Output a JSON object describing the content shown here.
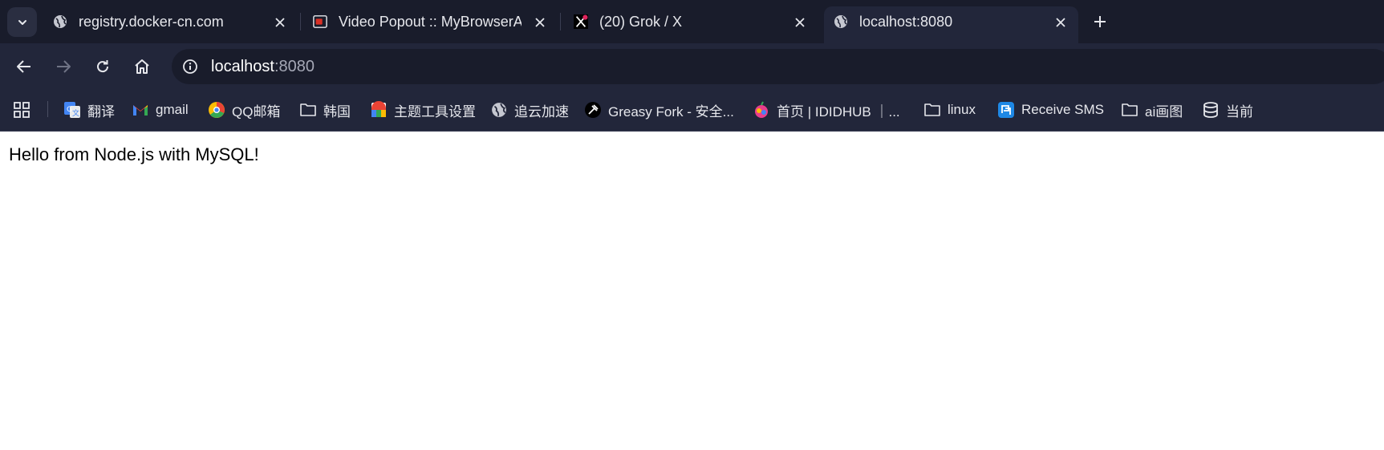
{
  "tabs": [
    {
      "title": "registry.docker-cn.com",
      "favicon": "globe-icon",
      "active": false
    },
    {
      "title": "Video Popout :: MyBrowserAd",
      "favicon": "video-popout-icon",
      "active": false
    },
    {
      "title": "(20) Grok / X",
      "favicon": "x-logo-icon",
      "active": false
    },
    {
      "title": "localhost:8080",
      "favicon": "globe-icon",
      "active": true
    }
  ],
  "toolbar": {
    "url_host": "localhost",
    "url_port": ":8080"
  },
  "bookmarks": [
    {
      "label": "翻译",
      "icon": "google-translate-icon"
    },
    {
      "label": "gmail",
      "icon": "gmail-icon"
    },
    {
      "label": "QQ邮箱",
      "icon": "qq-mail-icon"
    },
    {
      "label": "韩国",
      "icon": "folder-icon"
    },
    {
      "label": "主题工具设置",
      "icon": "theme-tool-icon"
    },
    {
      "label": "追云加速",
      "icon": "globe-icon"
    },
    {
      "label": "Greasy Fork - 安全...",
      "icon": "greasy-fork-icon"
    },
    {
      "label": "首页 | IDIDHUB ｜...",
      "icon": "idid-icon"
    },
    {
      "label": "linux",
      "icon": "folder-icon"
    },
    {
      "label": "Receive SMS",
      "icon": "receive-sms-icon"
    },
    {
      "label": "ai画图",
      "icon": "folder-icon"
    },
    {
      "label": "当前",
      "icon": "database-icon"
    }
  ],
  "page": {
    "message": "Hello from Node.js with MySQL!"
  },
  "colors": {
    "tabbar_bg": "#191c2b",
    "toolbar_bg": "#22263a",
    "text_light": "#e6e7ec",
    "url_dim": "#a5a8b6"
  }
}
